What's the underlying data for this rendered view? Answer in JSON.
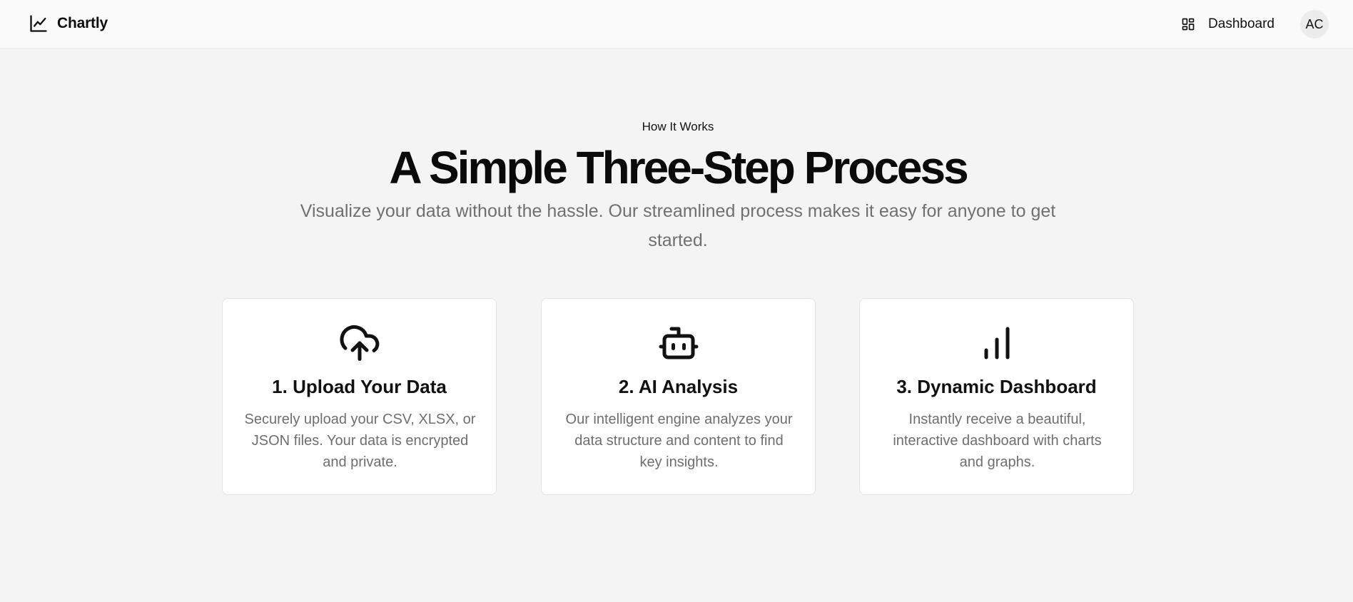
{
  "header": {
    "brand_icon": "line-chart-icon",
    "brand_name": "Chartly",
    "dashboard_icon": "layout-grid-icon",
    "dashboard_label": "Dashboard",
    "avatar_initials": "AC"
  },
  "hero": {
    "eyebrow": "How It Works",
    "title": "A Simple Three-Step Process",
    "subtitle": "Visualize your data without the hassle. Our streamlined process makes it easy for anyone to get started."
  },
  "steps": [
    {
      "icon": "cloud-upload-icon",
      "title": "1. Upload Your Data",
      "description": "Securely upload your CSV, XLSX, or JSON files. Your data is encrypted and private."
    },
    {
      "icon": "bot-icon",
      "title": "2. AI Analysis",
      "description": "Our intelligent engine analyzes your data structure and content to find key insights."
    },
    {
      "icon": "bar-chart-icon",
      "title": "3. Dynamic Dashboard",
      "description": "Instantly receive a beautiful, interactive dashboard with charts and graphs."
    }
  ],
  "colors": {
    "page_background": "#f4f4f4",
    "header_background": "#fafafa",
    "card_background": "#ffffff",
    "text_primary": "#0d0d0d",
    "text_muted": "#707070"
  }
}
